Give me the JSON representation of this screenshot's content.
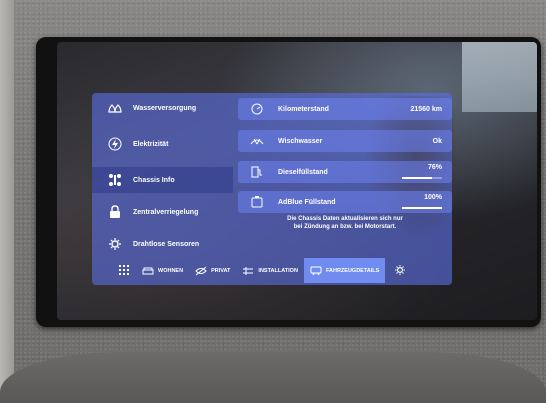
{
  "sidebar": {
    "items": [
      {
        "label": "Wasserversorgung",
        "icon": "water-drops-icon"
      },
      {
        "label": "Elektrizität",
        "icon": "lightning-icon"
      },
      {
        "label": "Chassis Info",
        "icon": "chassis-icon",
        "active": true
      },
      {
        "label": "Zentralverriegelung",
        "icon": "lock-icon"
      },
      {
        "label": "Drahtlose Sensoren",
        "icon": "gear-sensor-icon"
      }
    ]
  },
  "chassis": {
    "rows": [
      {
        "label": "Kilometerstand",
        "value": "21560 km",
        "icon": "speedometer-icon"
      },
      {
        "label": "Wischwasser",
        "value": "Ok",
        "icon": "wiper-icon"
      },
      {
        "label": "Dieselfüllstand",
        "value": "76%",
        "icon": "fuel-pump-icon",
        "level": 0.76
      },
      {
        "label": "AdBlue Füllstand",
        "value": "100%",
        "icon": "adblue-icon",
        "level": 1.0
      }
    ],
    "note_line1": "Die Chassis Daten aktualisieren sich nur",
    "note_line2": "bei Zündung an bzw. bei Motorstart."
  },
  "nav": {
    "items": [
      {
        "label": "WOHNEN",
        "icon": "sofa-icon"
      },
      {
        "label": "PRIVAT",
        "icon": "privacy-icon"
      },
      {
        "label": "INSTALLATION",
        "icon": "installation-icon"
      },
      {
        "label": "FAHRZEUGDETAILS",
        "icon": "vehicle-icon",
        "active": true
      }
    ]
  },
  "colors": {
    "panel": "#5a6ee1",
    "active_tab": "#7896ff",
    "text": "#ffffff"
  }
}
